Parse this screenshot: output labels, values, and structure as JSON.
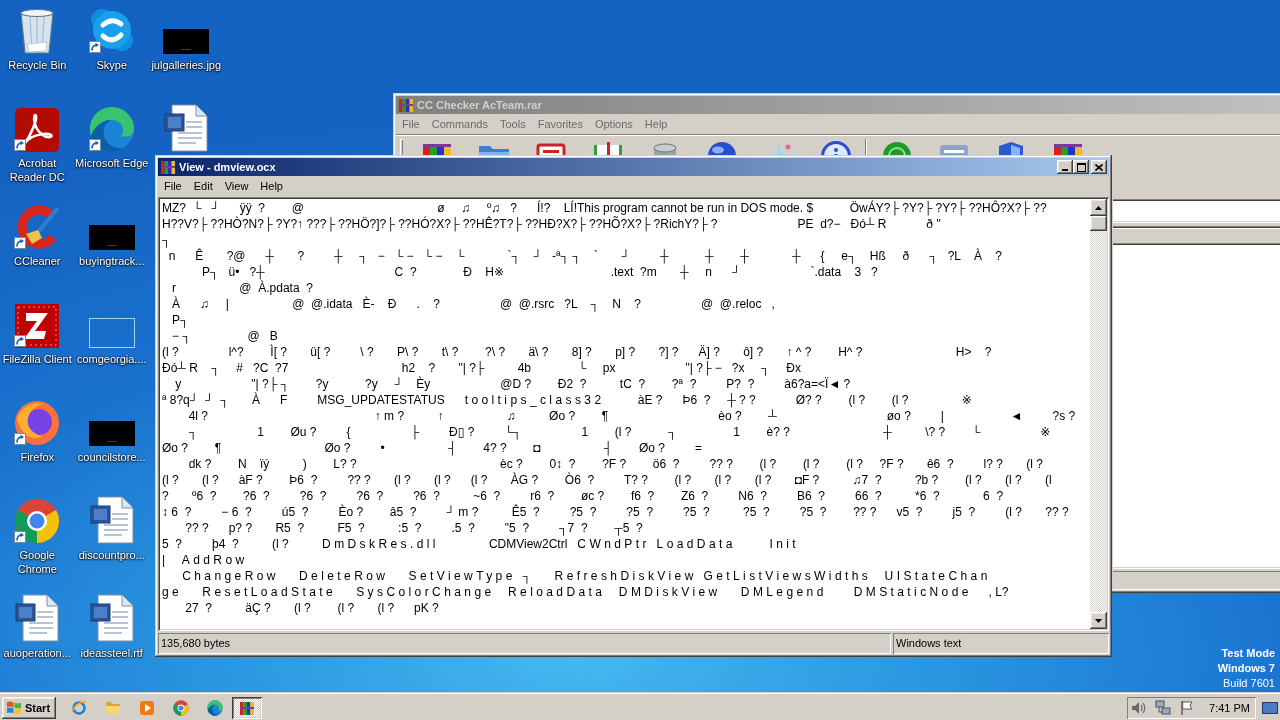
{
  "desktop": {
    "icons": [
      {
        "label": "Recycle Bin",
        "kind": "recycle-bin",
        "shortcut": false
      },
      {
        "label": "Acrobat Reader DC",
        "kind": "acrobat",
        "shortcut": true
      },
      {
        "label": "CCleaner",
        "kind": "ccleaner",
        "shortcut": true
      },
      {
        "label": "FileZilla Client",
        "kind": "filezilla",
        "shortcut": true
      },
      {
        "label": "Firefox",
        "kind": "firefox",
        "shortcut": true
      },
      {
        "label": "Google Chrome",
        "kind": "chrome",
        "shortcut": true
      },
      {
        "label": "auoperation...",
        "kind": "word-doc",
        "shortcut": false
      },
      {
        "label": "Skype",
        "kind": "skype",
        "shortcut": true
      },
      {
        "label": "Microsoft Edge",
        "kind": "edge",
        "shortcut": true
      },
      {
        "label": "buyingtrack...",
        "kind": "dark-image",
        "shortcut": false
      },
      {
        "label": "comgeorgia....",
        "kind": "blank-image",
        "shortcut": false
      },
      {
        "label": "councilstore...",
        "kind": "dark-image",
        "shortcut": false
      },
      {
        "label": "discountpro...",
        "kind": "word-doc",
        "shortcut": false
      },
      {
        "label": "ideassteel.rtf",
        "kind": "word-doc",
        "shortcut": false
      },
      {
        "label": "julgalleries.jpg",
        "kind": "dark-image",
        "shortcut": false
      },
      {
        "kind": "word-doc",
        "shortcut": false
      }
    ],
    "notice": [
      "Test Mode",
      "Windows 7",
      "Build 7601"
    ]
  },
  "archive_window": {
    "title": "CC Checker AcTeam.rar",
    "active": false,
    "menu": [
      "File",
      "Commands",
      "Tools",
      "Favorites",
      "Options",
      "Help"
    ],
    "toolbar": [
      {
        "kind": "books"
      },
      {
        "kind": "folder"
      },
      {
        "kind": "case"
      },
      {
        "kind": "book"
      },
      {
        "kind": "cylinder"
      },
      {
        "kind": "globe"
      },
      {
        "kind": "sparkle"
      },
      {
        "kind": "info"
      },
      {
        "kind": "separator"
      },
      {
        "kind": "disc"
      },
      {
        "kind": "card"
      },
      {
        "kind": "shield"
      },
      {
        "kind": "books"
      }
    ]
  },
  "viewer_window": {
    "title": "View - dmview.ocx",
    "active": true,
    "menu": [
      "File",
      "Edit",
      "View",
      "Help"
    ],
    "lines": [
      [
        {
          "kind": "plain",
          "text": "MZ?  └   ┘      ÿÿ  ?        @                                        ø     ♫     º♫   ?      Í!?    LÍ!This program cannot be run in DOS mode. $           ÖwÁY?├ ?Y?├ ?Y?├ ??HÔ?X?├ ??"
        }
      ],
      [
        {
          "kind": "plain",
          "text": "H??V?├ ??HÒ?N?├ ?Y?↑ ???├ ??HÖ?]?├ ??HÓ?X?├ ??HÊ?T?├ ??HÐ?X?├ ??HÕ?X?├ ?RichY?├ ?                        PE  d?−   Ðó┴ R            ð \""
        }
      ],
      [
        {
          "kind": "plain",
          "text": "┐"
        }
      ],
      [
        {
          "kind": "plain",
          "text": "  n      Ê       ?@      ┼       ?         ┼     ┐   −   └ −   └ −    └             `┐    ┘   -ª┐ ┐    `       ┘         ┼           ┼        ┼             ┼      {     e┐    Hß     ð      ┐   ?L    À    ?"
        }
      ],
      [
        {
          "kind": "plain",
          "text": "            P┐   ü•   ?┼                                       C  ?              Ð    H※                                .text  ?m       ┼     n      ┘                     `.data    3   ?"
        }
      ],
      [
        {
          "kind": "plain",
          "text": "   r                   @  À.pdata  ?"
        }
      ],
      [
        {
          "kind": "plain",
          "text": "   À      ♫     |                   @  @.idata   È-    Ð      .    ?                  @  @.rsrc   ?L    ┐    N    ?                  @  @.reloc   ,"
        }
      ],
      [
        {
          "kind": "plain",
          "text": "   P┐"
        }
      ],
      [
        {
          "kind": "plain",
          "text": "   − ┐                 @   B"
        }
      ],
      [
        {
          "kind": "plain",
          "text": "(l ?               l^?        Ì[ ?       ü[ ?         \\ ?       P\\ ?       t\\ ?        ?\\ ?       ä\\ ?       8] ?       p] ?       ?] ?      Ä] ?       ô] ?       ↑ ^ ?        H^ ?                            H>    ?"
        }
      ],
      [
        {
          "kind": "plain",
          "text": "Ðó┴ R    ┐     #   ?C  ?7                                  h2    ?       \"| ?├          4b              └     px                     \"| ?├ −   ?x     ┐     Ðx"
        }
      ],
      [
        {
          "kind": "plain",
          "text": "    y                     \"| ?├ ┐        ?y           ?y     ┘    Èy                     @D ?        Ð2  ?          tC  ?        ?ª  ?         P?  ?         à6?a=<Ï◄ ?"
        }
      ],
      [
        {
          "kind": "plain",
          "text": "ª 8?q┘  ┘  ┐       À      F         MSG_UPDATESTATUS      "
        },
        {
          "kind": "wide",
          "text": "tooltips_class32"
        },
        {
          "kind": "plain",
          "text": "          àE ?      Þ6  ?     ┼ ? ?            Ø? ?        (l ?        (l ?                ※"
        }
      ],
      [
        {
          "kind": "plain",
          "text": "        4l ?                                                  ↑ m ?          ↑                   ♫          Øo ?        ¶                                 èo ?        ┴                                 øo ?         |                    ◄         ?s ?"
        }
      ],
      [
        {
          "kind": "plain",
          "text": "        ┐                  1        Øu ?         {                  ├         Ð▯ ?         └┐                  1        (l ?           ┐                 1        è? ?                            ┼          \\? ?        └                  ※"
        }
      ],
      [
        {
          "kind": "plain",
          "text": "Øo ?        ¶                               Øo ?         •                   ┤        4? ?        ◘                   ┤        Øo ?         ="
        }
      ],
      [
        {
          "kind": "plain",
          "text": "        dk ?        N    ïý          )        L? ?                                           èc ?        0↕  ?        ?F ?        ö6  ?         ?? ?        (l ?        (l ?        (l ?     ?F ?       ê6  ?         l? ?       (l ?"
        }
      ],
      [
        {
          "kind": "plain",
          "text": "(l ?       (l ?      àF ?        Þ6  ?         ?? ?       (l ?       (l ?      (l ?       ÀG ?        Ò6  ?         T? ?        (l ?       (l ?       (l ?       ◘F ?          ♫7  ?          ?b ?        (l ?       (l ?       (l"
        }
      ],
      [
        {
          "kind": "plain",
          "text": "?       º6  ?        ?6  ?         ?6  ?         ?6  ?         ?6  ?          ~6  ?         r6  ?        øc ?        f6  ?        Z6  ?         N6  ?         B6  ?         66  ?          *6  ?             6  ?"
        }
      ],
      [
        {
          "kind": "plain",
          "text": "↕ 6  ?         − 6  ?         ú5  ?         Èo ?        â5  ?         ┘ m ?          Ê5  ?         ?5  ?         ?5  ?         ?5  ?          ?5  ?         ?5  ?        ?? ?      v5  ?         j5  ?         (l ?       ?? ?"
        }
      ],
      [
        {
          "kind": "plain",
          "text": "       ?? ?      p? ?       R5  ?          F5  ?          :5  ?         .5  ?         \"5  ?         ┐7  ?        ┬5  ?"
        }
      ],
      [
        {
          "kind": "plain",
          "text": "5  ?         þ4  ?          (l ?          "
        },
        {
          "kind": "wide",
          "text": "DmDskRes.dll"
        },
        {
          "kind": "plain",
          "text": "               CDMView2Ctrl   "
        },
        {
          "kind": "wide",
          "text": "CWndPtr LoadData     Init"
        }
      ],
      [
        {
          "kind": "plain",
          "text": "|     "
        },
        {
          "kind": "wide",
          "text": "AddRow"
        }
      ],
      [
        {
          "kind": "wide",
          "text": "   ChangeRow   DeleteRow   SetViewType ┐   RefreshDiskView GetListViewsWidths  UIStateChan"
        }
      ],
      [
        {
          "kind": "wide",
          "text": "ge   ResetLoadState   SysColorChange  ReloadData  DMDiskView   DMLegend    DMStaticNode"
        },
        {
          "kind": "plain",
          "text": "     , L?"
        }
      ],
      [
        {
          "kind": "plain",
          "text": "       27  ?          äÇ ?       (l ?        (l ?       (l ?      pK ?"
        }
      ]
    ],
    "status": [
      "135,680 bytes",
      "Windows text"
    ]
  },
  "taskbar": {
    "start": "Start",
    "quick_launch": [
      {
        "kind": "ie"
      },
      {
        "kind": "folder"
      },
      {
        "kind": "media-player"
      },
      {
        "kind": "chrome"
      },
      {
        "kind": "edge"
      }
    ],
    "tasks": [
      {
        "kind": "winrar",
        "selected": true
      }
    ],
    "tray": [
      {
        "kind": "speaker"
      },
      {
        "kind": "network"
      },
      {
        "kind": "flag"
      }
    ],
    "clock": "7:41 PM"
  }
}
